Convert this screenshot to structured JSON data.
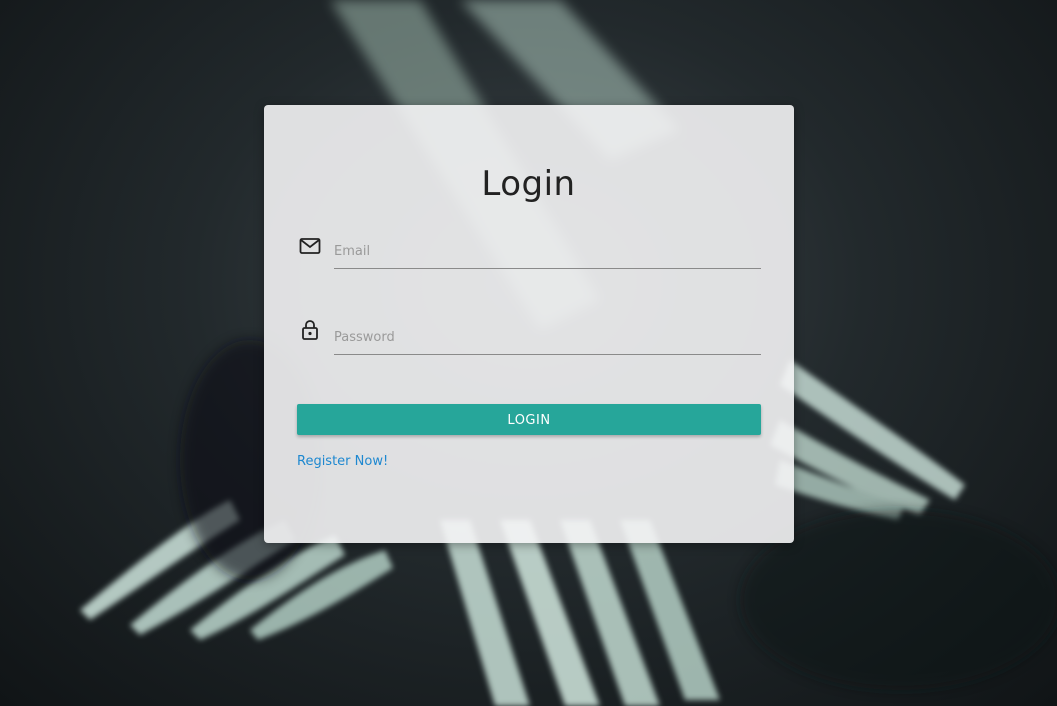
{
  "login_form": {
    "title": "Login",
    "email": {
      "placeholder": "Email",
      "value": "",
      "icon": "envelope-icon"
    },
    "password": {
      "placeholder": "Password",
      "value": "",
      "icon": "lock-icon"
    },
    "submit_label": "LOGIN",
    "register_link": "Register Now!"
  },
  "colors": {
    "accent": "#26a69a",
    "link": "#1e88d0",
    "card": "#f4f4f5"
  },
  "background": {
    "description": "blurred dark photo of forks"
  }
}
